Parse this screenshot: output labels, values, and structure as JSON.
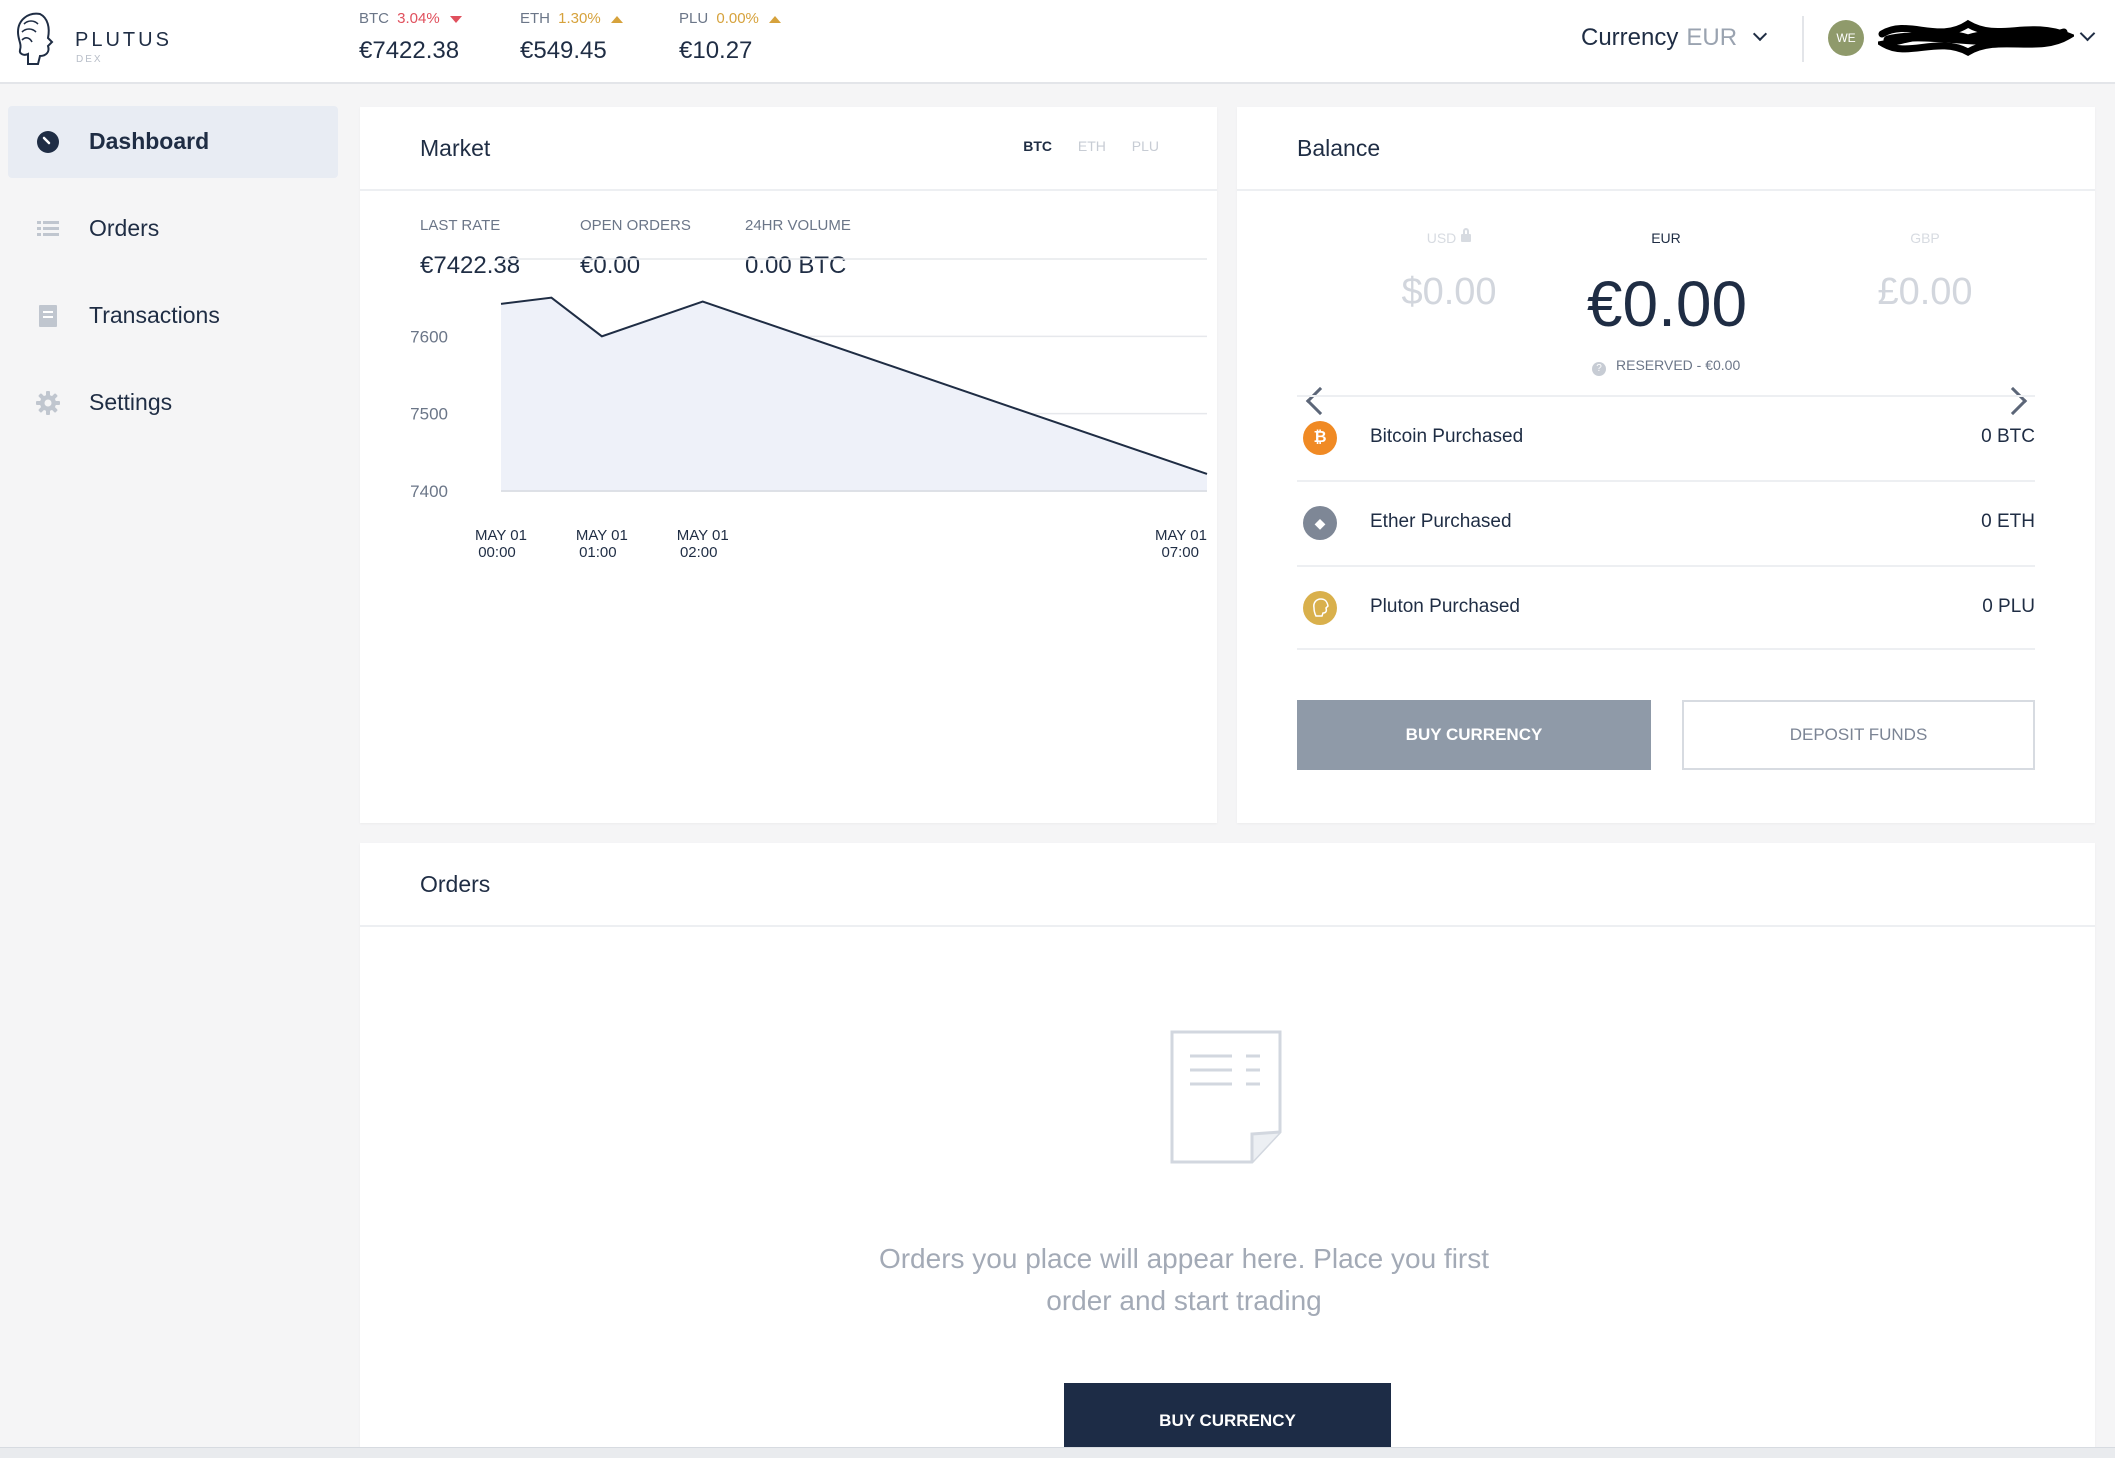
{
  "brand": {
    "name": "PLUTUS",
    "sub": "DEX"
  },
  "tickers": [
    {
      "symbol": "BTC",
      "change": "3.04%",
      "direction": "down",
      "price": "€7422.38"
    },
    {
      "symbol": "ETH",
      "change": "1.30%",
      "direction": "up",
      "price": "€549.45"
    },
    {
      "symbol": "PLU",
      "change": "0.00%",
      "direction": "up",
      "price": "€10.27"
    }
  ],
  "header": {
    "currency_label": "Currency",
    "currency_value": "EUR",
    "avatar_initials": "WE"
  },
  "sidebar": {
    "items": [
      {
        "label": "Dashboard",
        "icon": "dashboard-icon",
        "active": true
      },
      {
        "label": "Orders",
        "icon": "list-icon",
        "active": false
      },
      {
        "label": "Transactions",
        "icon": "document-icon",
        "active": false
      },
      {
        "label": "Settings",
        "icon": "gear-icon",
        "active": false
      }
    ]
  },
  "market": {
    "title": "Market",
    "tabs": [
      "BTC",
      "ETH",
      "PLU"
    ],
    "active_tab": "BTC",
    "stats": [
      {
        "label": "LAST RATE",
        "value": "€7422.38"
      },
      {
        "label": "OPEN ORDERS",
        "value": "€0.00"
      },
      {
        "label": "24HR VOLUME",
        "value": "0.00 BTC"
      }
    ]
  },
  "chart_data": {
    "type": "area",
    "title": "",
    "xlabel": "",
    "ylabel": "",
    "x": [
      "2018-05-01 00:00",
      "2018-05-01 00:30",
      "2018-05-01 01:00",
      "2018-05-01 02:00",
      "2018-05-01 07:00"
    ],
    "y": [
      7642,
      7650,
      7600,
      7645,
      7422
    ],
    "x_ticks": [
      {
        "line1": "MAY 01",
        "line2": "00:00",
        "index": 0
      },
      {
        "line1": "MAY 01",
        "line2": "01:00",
        "index": 2
      },
      {
        "line1": "MAY 01",
        "line2": "02:00",
        "index": 3
      },
      {
        "line1": "MAY 01",
        "line2": "07:00",
        "index": 4
      }
    ],
    "y_ticks": [
      7400,
      7500,
      7600
    ],
    "ylim": [
      7400,
      7700
    ],
    "grid": true,
    "colors": {
      "line": "#1f2d44",
      "fill": "#eef1f9",
      "grid": "#e6e8ec"
    }
  },
  "balance": {
    "title": "Balance",
    "currencies": [
      {
        "code": "USD",
        "amount": "$0.00",
        "locked": true
      },
      {
        "code": "EUR",
        "amount": "€0.00",
        "locked": false
      },
      {
        "code": "GBP",
        "amount": "£0.00",
        "locked": false
      }
    ],
    "reserved": "RESERVED - €0.00",
    "assets": [
      {
        "name": "Bitcoin Purchased",
        "value": "0 BTC",
        "icon": "bitcoin-icon",
        "glyph": "₿",
        "color": "#f08a24"
      },
      {
        "name": "Ether Purchased",
        "value": "0 ETH",
        "icon": "ether-icon",
        "glyph": "◆",
        "color": "#7e8796"
      },
      {
        "name": "Pluton Purchased",
        "value": "0 PLU",
        "icon": "pluton-icon",
        "glyph": "",
        "color": "#d9b04c"
      }
    ],
    "buy_label": "BUY CURRENCY",
    "deposit_label": "DEPOSIT FUNDS"
  },
  "orders": {
    "title": "Orders",
    "empty_message": "Orders you place will appear here. Place you first order and start trading",
    "buy_label": "BUY CURRENCY"
  }
}
